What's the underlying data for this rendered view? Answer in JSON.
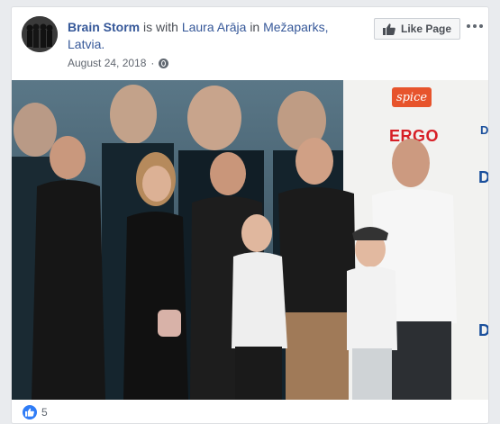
{
  "post": {
    "page_name": "Brain Storm",
    "is_with": "is with",
    "tagged_person": "Laura Arāja",
    "in_word": "in",
    "location": "Mežaparks, Latvia.",
    "date": "August 24, 2018",
    "separator": "·",
    "privacy_icon": "globe-icon"
  },
  "actions": {
    "like_page_label": "Like Page",
    "more_icon": "ellipsis-icon"
  },
  "photo": {
    "backdrop_logos": [
      "spice",
      "ERGO"
    ]
  },
  "reactions": {
    "icon": "like-icon",
    "count": "5"
  },
  "colors": {
    "link": "#365899",
    "like_blue": "#2f7cf6",
    "spice": "#e7542c",
    "ergo": "#d71f26"
  }
}
